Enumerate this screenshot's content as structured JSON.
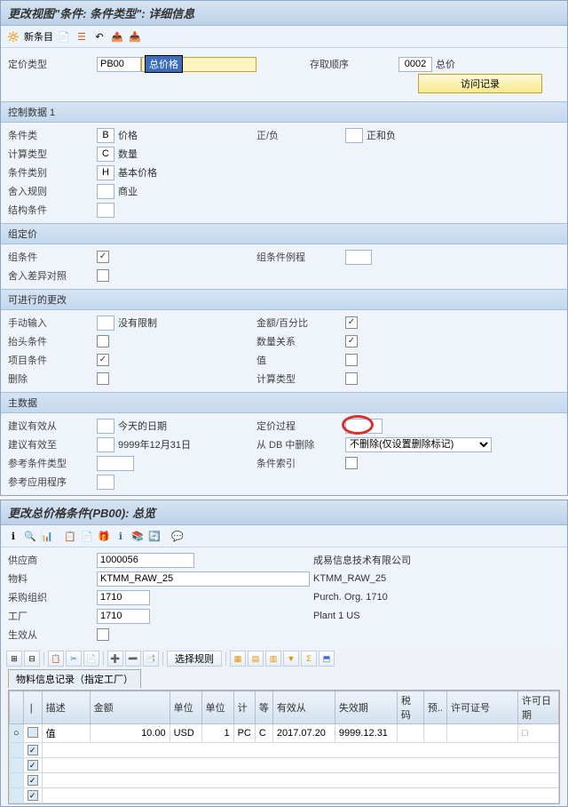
{
  "win1": {
    "title": "更改视图\"条件: 条件类型\": 详细信息",
    "new_entry": "新条目",
    "top": {
      "pricing_type_label": "定价类型",
      "pricing_type_code": "PB00",
      "highlight": "总价格",
      "access_seq_label": "存取顺序",
      "access_seq_code": "0002",
      "access_seq_name": "总价",
      "visit_btn": "访问记录"
    },
    "sec_control": {
      "header": "控制数据 1",
      "cond_class_label": "条件类",
      "cond_class_code": "B",
      "cond_class_text": "价格",
      "plusminus_label": "正/负",
      "plusminus_text": "正和负",
      "calc_type_label": "计算类型",
      "calc_type_code": "C",
      "calc_type_text": "数量",
      "cond_cat_label": "条件类别",
      "cond_cat_code": "H",
      "cond_cat_text": "基本价格",
      "rounding_label": "舍入规则",
      "rounding_text": "商业",
      "struct_label": "结构条件"
    },
    "sec_group": {
      "header": "组定价",
      "group_cond_label": "组条件",
      "group_proc_label": "组条件例程",
      "round_diff_label": "舍入差异对照"
    },
    "sec_changes": {
      "header": "可进行的更改",
      "manual_label": "手动输入",
      "manual_text": "没有限制",
      "amount_label": "金额/百分比",
      "header_cond_label": "抬头条件",
      "qty_rel_label": "数量关系",
      "item_cond_label": "项目条件",
      "value_label": "值",
      "delete_label": "删除",
      "calc_type2_label": "计算类型"
    },
    "sec_master": {
      "header": "主数据",
      "valid_from_label": "建议有效从",
      "valid_from_text": "今天的日期",
      "pricing_proc_label": "定价过程",
      "valid_to_label": "建议有效至",
      "valid_to_text": "9999年12月31日",
      "db_delete_label": "从 DB 中删除",
      "db_delete_option": "不删除(仅设置删除标记)",
      "ref_cond_label": "参考条件类型",
      "cond_index_label": "条件索引",
      "ref_app_label": "参考应用程序"
    }
  },
  "win2": {
    "title": "更改总价格条件(PB00): 总览",
    "hdr": {
      "vendor_label": "供应商",
      "vendor_code": "1000056",
      "vendor_name": "成易信息技术有限公司",
      "material_label": "物料",
      "material_code": "KTMM_RAW_25",
      "material_name": "KTMM_RAW_25",
      "purch_org_label": "采购组织",
      "purch_org_code": "1710",
      "purch_org_name": "Purch. Org. 1710",
      "plant_label": "工厂",
      "plant_code": "1710",
      "plant_name": "Plant 1 US",
      "valid_from_label": "生效从"
    },
    "select_rule": "选择规则",
    "tab": "物料信息记录（指定工厂）",
    "cols": {
      "desc": "描述",
      "amount": "金额",
      "unit": "单位",
      "unit2": "单位",
      "calc": "计",
      "grade": "等",
      "valid_from": "有效从",
      "valid_to": "失效期",
      "tax": "税码",
      "budget": "预..",
      "license": "许可证号",
      "license_date": "许可日期"
    },
    "rows": [
      {
        "desc": "值",
        "amount": "10.00",
        "unit": "USD",
        "unit2": "1",
        "calc": "PC",
        "grade": "C",
        "valid_from": "2017.07.20",
        "valid_to": "9999.12.31"
      }
    ]
  }
}
